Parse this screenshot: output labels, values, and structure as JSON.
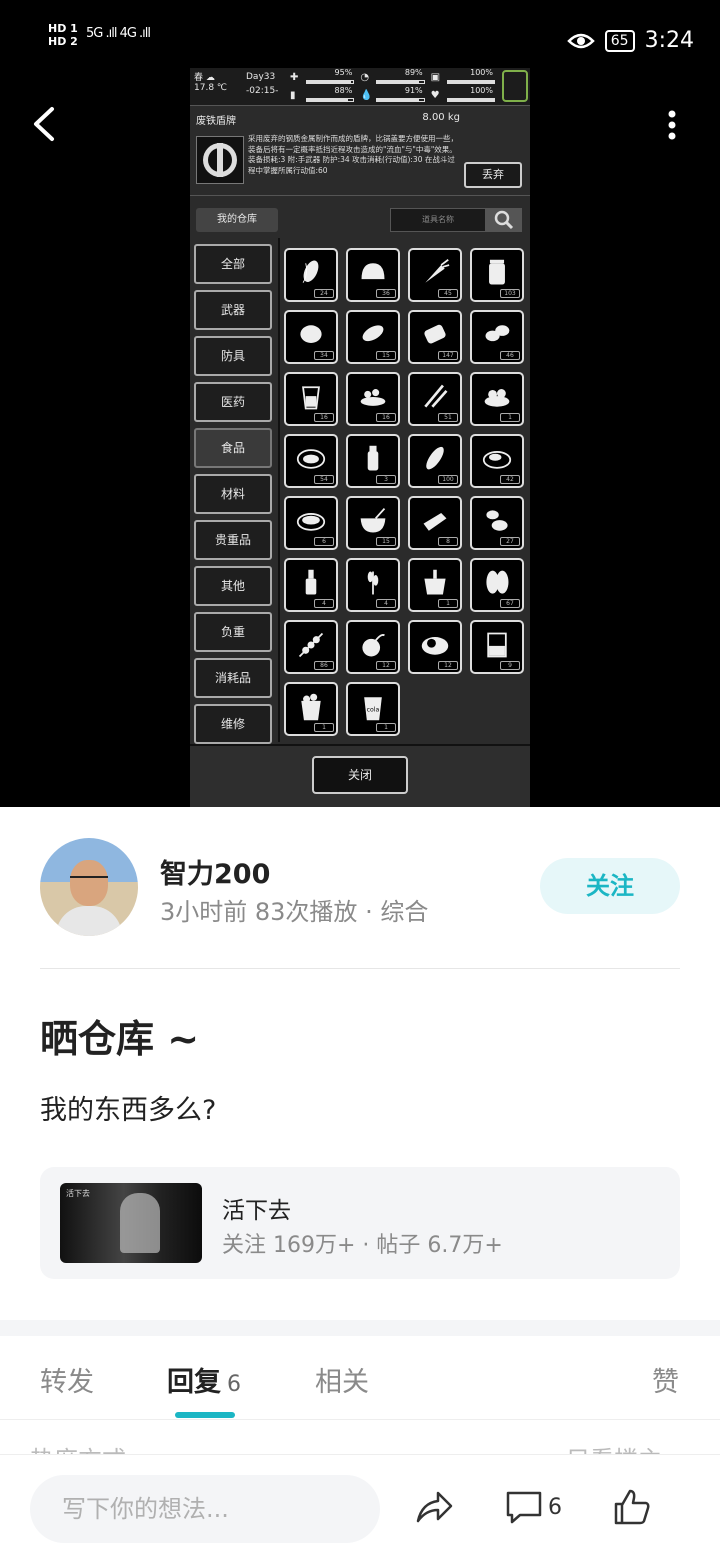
{
  "status_bar": {
    "left_top": "HD 1",
    "left_bottom": "HD 2",
    "signal": "5G .ıll 4G .ıll",
    "battery": "65",
    "time": "3:24"
  },
  "game": {
    "season": "春",
    "temp": "17.8 ℃",
    "day": "Day33",
    "clock": "-02:15-",
    "stats": [
      "95%",
      "89%",
      "100%",
      "88%",
      "91%",
      "100%"
    ],
    "stat_levels": [
      0.95,
      0.89,
      1.0,
      0.88,
      0.91,
      1.0
    ],
    "item_name": "废铁盾牌",
    "item_weight": "8.00 kg",
    "item_desc": "采用废弃的钢质金属制作而成的盾牌，比锅盖要方便使用一些，装备后将有一定概率抵挡近程攻击造成的\"流血\"与\"中毒\"效果。装备损耗:3 附:手武器 防护:34 攻击消耗(行动值):30 在战斗过程中掌握所属行动值:60",
    "drop_label": "丢弃",
    "warehouse_label": "我的仓库",
    "search_placeholder": "道具名称",
    "categories": [
      "全部",
      "武器",
      "防具",
      "医药",
      "食品",
      "材料",
      "贵重品",
      "其他",
      "负重",
      "消耗品",
      "维修"
    ],
    "selected_category": "食品",
    "items": [
      {
        "name": "corn",
        "count": "24"
      },
      {
        "name": "bread",
        "count": "36"
      },
      {
        "name": "carrot",
        "count": "45"
      },
      {
        "name": "jar",
        "count": "103"
      },
      {
        "name": "potato",
        "count": "34"
      },
      {
        "name": "sweet-potato",
        "count": "15"
      },
      {
        "name": "can",
        "count": "147"
      },
      {
        "name": "beans",
        "count": "46"
      },
      {
        "name": "juice",
        "count": "16"
      },
      {
        "name": "dumplings",
        "count": "16"
      },
      {
        "name": "bean-pods",
        "count": "51"
      },
      {
        "name": "salad",
        "count": "1"
      },
      {
        "name": "soup",
        "count": "54"
      },
      {
        "name": "pepper-shaker",
        "count": "3"
      },
      {
        "name": "baguette",
        "count": "100"
      },
      {
        "name": "stew",
        "count": "42"
      },
      {
        "name": "noodle-bowl",
        "count": "6"
      },
      {
        "name": "porridge",
        "count": "15"
      },
      {
        "name": "cheese",
        "count": "8"
      },
      {
        "name": "nuts",
        "count": "27"
      },
      {
        "name": "bottle",
        "count": "4"
      },
      {
        "name": "wheat",
        "count": "4"
      },
      {
        "name": "bucket",
        "count": "1"
      },
      {
        "name": "seeds",
        "count": "67"
      },
      {
        "name": "skewer",
        "count": "86"
      },
      {
        "name": "onion",
        "count": "12"
      },
      {
        "name": "fried-egg",
        "count": "12"
      },
      {
        "name": "beaker",
        "count": "9"
      },
      {
        "name": "popcorn",
        "count": "1"
      },
      {
        "name": "cola",
        "count": "1"
      }
    ],
    "close_label": "关闭"
  },
  "post": {
    "author": "智力200",
    "meta": "3小时前   83次播放 · 综合",
    "follow_label": "关注",
    "title": "晒仓库 ~",
    "content": "我的东西多么?",
    "card": {
      "name": "活下去",
      "stats": "关注 169万+ · 帖子 6.7万+",
      "thumb_text": "活下去"
    }
  },
  "tabs": {
    "repost": "转发",
    "reply": "回复",
    "reply_count": "6",
    "related": "相关",
    "like": "赞"
  },
  "peek": {
    "left": "热度方式",
    "right": "只看楼主"
  },
  "bottom": {
    "placeholder": "写下你的想法...",
    "comment_count": "6"
  },
  "colors": {
    "accent": "#1bb6c4",
    "follow_bg": "#e6f7f9"
  }
}
